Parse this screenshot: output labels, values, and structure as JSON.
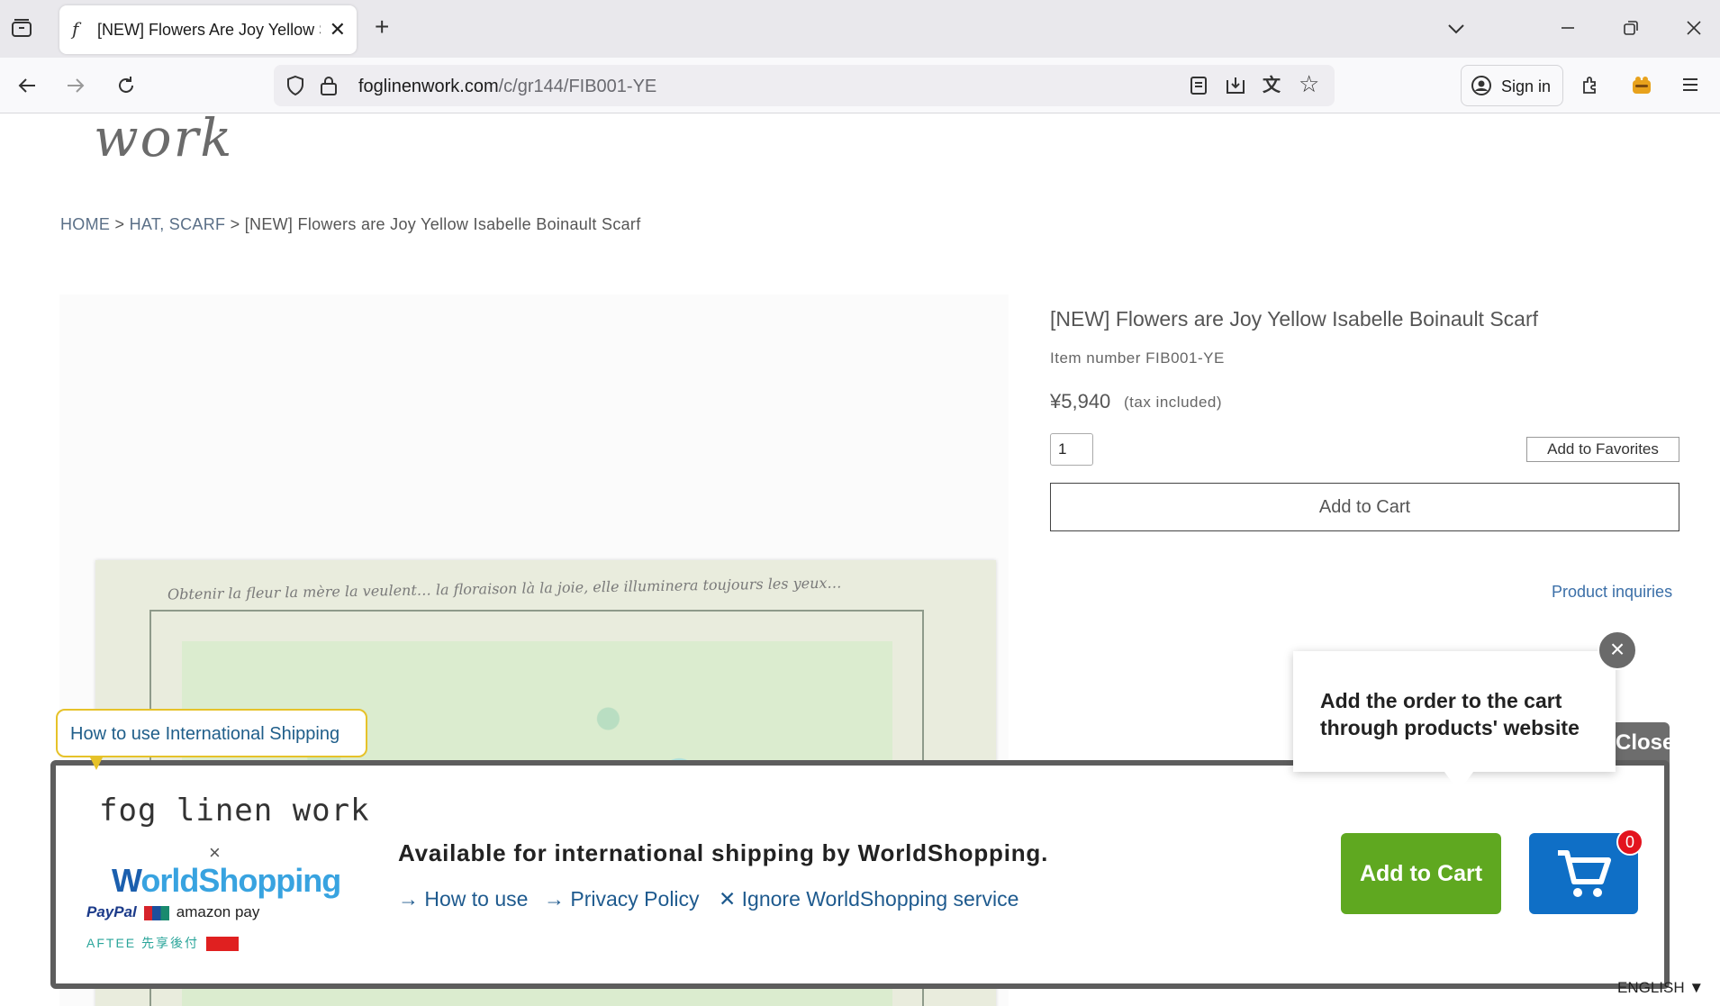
{
  "browser": {
    "tab_title": "[NEW] Flowers Are Joy Yellow Scarf",
    "url_host": "foglinenwork.com",
    "url_path": "/c/gr144/FIB001-YE",
    "sign_in": "Sign in"
  },
  "site": {
    "logo_text": "work"
  },
  "breadcrumb": {
    "home": "HOME",
    "sep1": " > ",
    "category": "HAT, SCARF",
    "sep2": " > ",
    "current": "[NEW] Flowers are Joy Yellow Isabelle Boinault Scarf"
  },
  "product": {
    "scarf_script": "Obtenir la fleur la mère la veulent… la floraison là la joie, elle illuminera toujours les yeux…",
    "title": "[NEW] Flowers are Joy Yellow Isabelle Boinault Scarf",
    "item_number": "Item number FIB001-YE",
    "price": "¥5,940",
    "price_note": "(tax included)",
    "quantity": "1",
    "add_to_favorites": "Add to Favorites",
    "add_to_cart": "Add to Cart",
    "inquiries": "Product inquiries"
  },
  "worldshopping": {
    "tooltip": "Add the order to the cart through products' website",
    "close_tab": "Close",
    "how_to_bubble": "How to use International Shipping",
    "fog_logo": "fog linen work",
    "times": "×",
    "ws_logo_w": "W",
    "ws_logo_rest": "orldShopping",
    "paypal": "PayPal",
    "amazon": "amazon pay",
    "aftee": "AFTEE 先享後付",
    "headline": "Available for international shipping by WorldShopping.",
    "link_how": "→ How to use",
    "link_privacy": "→ Privacy Policy",
    "link_ignore": "✕ Ignore WorldShopping service",
    "cart_button": "Add to Cart",
    "cart_count": "0",
    "colors": {
      "green": "#5fa820",
      "blue": "#0f6fc6",
      "badge": "#e3131e"
    }
  },
  "language": "ENGLISH ▼",
  "icons": [
    "tab-list-icon",
    "new-tab-icon",
    "back-icon",
    "forward-icon",
    "reload-icon",
    "shield-icon",
    "lock-icon",
    "reader-view-icon",
    "save-icon",
    "translate-icon",
    "bookmark-star-icon",
    "account-icon",
    "extensions-icon",
    "profile-icon",
    "menu-icon",
    "list-all-tabs-icon",
    "minimize-icon",
    "restore-icon",
    "window-close-icon",
    "cart-icon"
  ]
}
